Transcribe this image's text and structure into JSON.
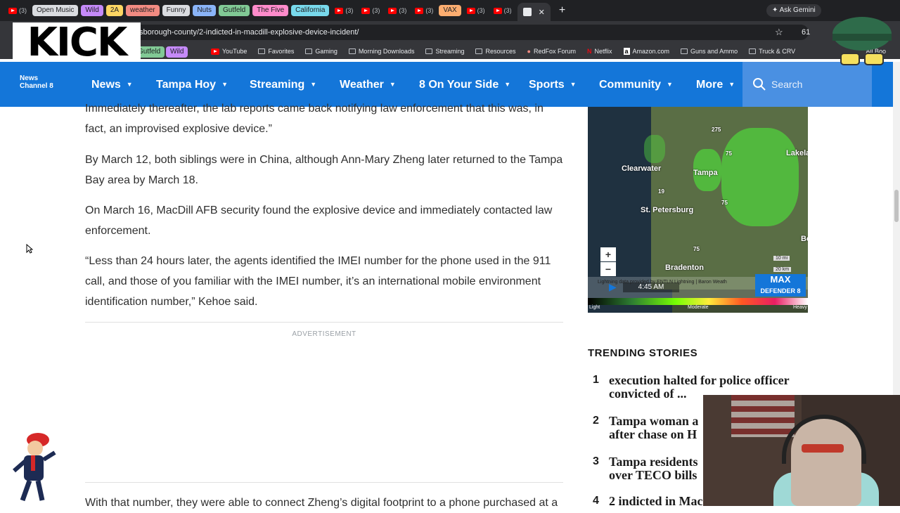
{
  "browser": {
    "tab_labels": [
      "Open Music",
      "Wild",
      "2A",
      "weather",
      "Funny",
      "Nuts",
      "Gutfeld",
      "The Five",
      "California",
      "VAX"
    ],
    "tab_colors": [
      "#dadce0",
      "#c58af9",
      "#fdd663",
      "#f28b82",
      "#dadce0",
      "#8ab4f8",
      "#81c995",
      "#ff8bcb",
      "#78d9ec",
      "#fcad70"
    ],
    "youtube_tab_text": "(3)",
    "ask_gemini": "Ask Gemini",
    "url": "sborough-county/2-indicted-in-macdill-explosive-device-incident/",
    "tab_count": "61",
    "bookmarks": [
      "YouTube",
      "Favorites",
      "Gaming",
      "Morning Downloads",
      "Streaming",
      "Resources",
      "RedFox Forum",
      "Netflix",
      "Amazon.com",
      "Guns and Ammo",
      "Truck & CRV"
    ],
    "bookmark_chips": [
      "Gutfeld",
      "Wild"
    ],
    "all_bookmarks": "All Boo"
  },
  "overlay": {
    "kick_logo": "KICK"
  },
  "site": {
    "logo_line1": "News",
    "logo_line2": "Channel 8",
    "nav": [
      "News",
      "Tampa Hoy",
      "Streaming",
      "Weather",
      "8 On Your Side",
      "Sports",
      "Community",
      "More"
    ],
    "search_placeholder": "Search"
  },
  "article": {
    "p1": "Immediately thereafter, the lab reports came back notifying law enforcement that this was, in fact, an improvised explosive device.”",
    "p2": "By March 12, both siblings were in China, although Ann-Mary Zheng later returned to the Tampa Bay area by March 18.",
    "p3": "On March 16, MacDill AFB security found the explosive device and immediately contacted law enforcement.",
    "p4": "“Less than 24 hours later, the agents identified the IMEI number for the phone used in the 911 call, and those of you familiar with the IMEI number, it’s an international mobile environment identification number,” Kehoe said.",
    "ad_label": "ADVERTISEMENT",
    "p5": "With that number, they were able to connect Zheng’s digital footprint to a phone purchased at a"
  },
  "radar": {
    "cities": [
      "Clearwater",
      "Tampa",
      "St. Petersburg",
      "Bradenton",
      "Lakela",
      "Bo"
    ],
    "time": "4:45 AM",
    "lightning_credit": "Lightning data provided by ENTLN Lightning | Baron Weath",
    "scale_10": "10 mi",
    "scale_20": "20 km",
    "zoom_in": "+",
    "zoom_out": "−",
    "legend": [
      "Light",
      "Moderate",
      "Heavy"
    ],
    "badge_line1": "MAX",
    "badge_line2": "DEFENDER 8",
    "road_labels": [
      "275",
      "75",
      "19",
      "75",
      "75"
    ]
  },
  "trending": {
    "title": "TRENDING STORIES",
    "items": [
      {
        "num": "1",
        "text": "execution halted for police officer convicted of ..."
      },
      {
        "num": "2",
        "text": "Tampa woman a after chase on H"
      },
      {
        "num": "3",
        "text": "Tampa residents over TECO bills"
      },
      {
        "num": "4",
        "text": "2 indicted in Mac"
      }
    ]
  }
}
